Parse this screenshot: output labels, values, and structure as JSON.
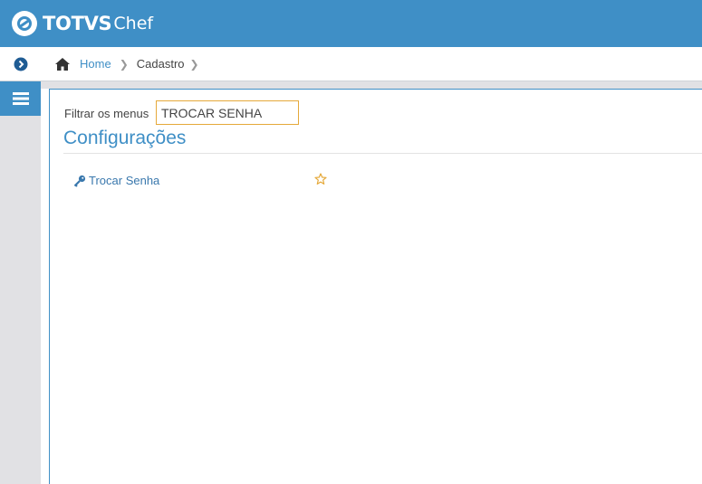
{
  "brand": {
    "name_bold": "TOTVS",
    "name_light": "Chef"
  },
  "breadcrumb": {
    "home_icon": "home-icon",
    "home_label": "Home",
    "current": "Cadastro"
  },
  "filter": {
    "label": "Filtrar os menus",
    "value": "TROCAR SENHA"
  },
  "section": {
    "title": "Configurações"
  },
  "entries": [
    {
      "icon": "key-icon",
      "label": "Trocar Senha",
      "favorite_icon": "star-outline-icon"
    }
  ],
  "colors": {
    "primary": "#3f8fc6",
    "rail": "#e1e1e4",
    "focus_border": "#e5a93a",
    "star": "#e5a93a"
  }
}
